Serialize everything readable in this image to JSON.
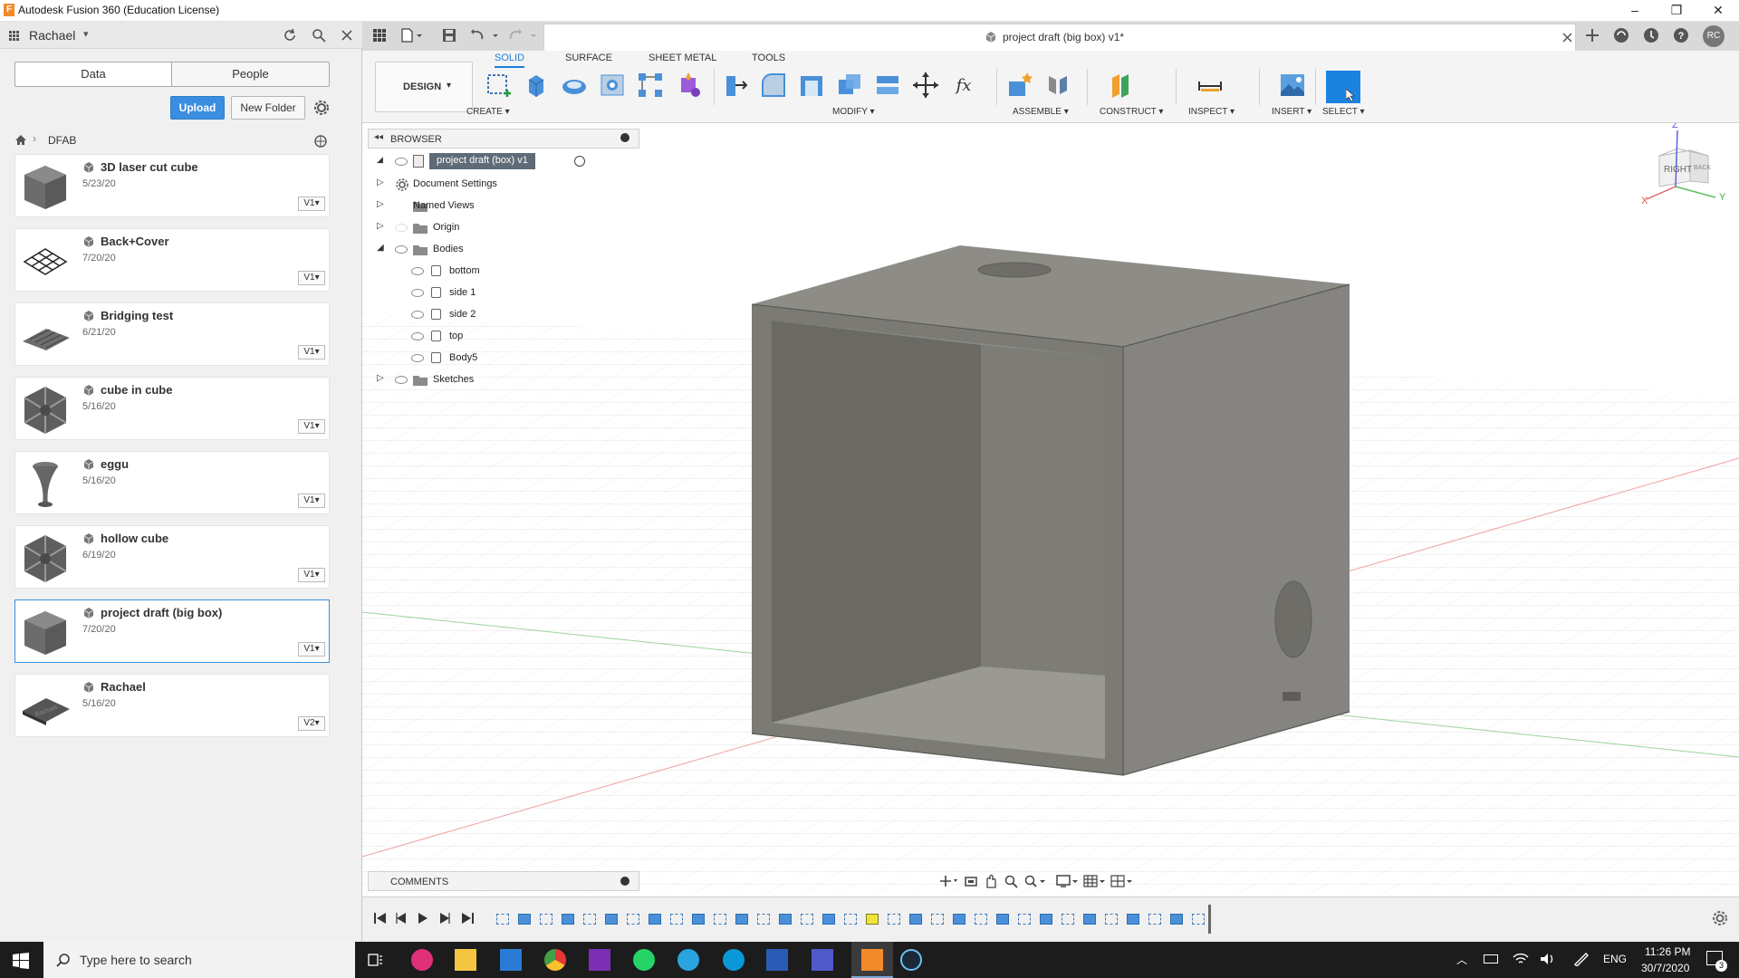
{
  "window": {
    "title": "Autodesk Fusion 360 (Education License)",
    "minimize": "–",
    "restore": "❐",
    "close": "✕"
  },
  "data_panel": {
    "user": "Rachael",
    "tabs": [
      "Data",
      "People"
    ],
    "upload": "Upload",
    "new_folder": "New Folder",
    "breadcrumb": "DFAB",
    "files": [
      {
        "name": "3D laser cut cube",
        "date": "5/23/20",
        "version": "V1",
        "thumb": "cube-thumb"
      },
      {
        "name": "Back+Cover",
        "date": "7/20/20",
        "version": "V1",
        "thumb": "grid-thumb"
      },
      {
        "name": "Bridging test",
        "date": "6/21/20",
        "version": "V1",
        "thumb": "plate-thumb"
      },
      {
        "name": "cube in cube",
        "date": "5/16/20",
        "version": "V1",
        "thumb": "hex-thumb"
      },
      {
        "name": "eggu",
        "date": "5/16/20",
        "version": "V1",
        "thumb": "cup-thumb"
      },
      {
        "name": "hollow cube",
        "date": "6/19/20",
        "version": "V1",
        "thumb": "hex-thumb"
      },
      {
        "name": "project draft (big box)",
        "date": "7/20/20",
        "version": "V1",
        "thumb": "cube-thumb",
        "selected": true
      },
      {
        "name": "Rachael",
        "date": "5/16/20",
        "version": "V2",
        "thumb": "tag-thumb"
      }
    ]
  },
  "document": {
    "tab_title": "project draft (big box) v1*"
  },
  "toolbar": {
    "workspace": "DESIGN",
    "tabs": [
      "SOLID",
      "SURFACE",
      "SHEET METAL",
      "TOOLS"
    ],
    "active_tab": "SOLID",
    "groups": [
      "CREATE",
      "MODIFY",
      "ASSEMBLE",
      "CONSTRUCT",
      "INSPECT",
      "INSERT",
      "SELECT"
    ]
  },
  "browser": {
    "title": "BROWSER",
    "root": "project draft (box) v1",
    "items": [
      "Document Settings",
      "Named Views",
      "Origin",
      "Bodies"
    ],
    "bodies": [
      "bottom",
      "side 1",
      "side 2",
      "top",
      "Body5"
    ],
    "sketches": "Sketches"
  },
  "viewcube": {
    "face": "RIGHT",
    "side": "BACK",
    "z": "Z",
    "x": "X",
    "y": "Y"
  },
  "comments": {
    "label": "COMMENTS"
  },
  "taskbar": {
    "search_placeholder": "Type here to search",
    "language": "ENG",
    "time": "11:26 PM",
    "date": "30/7/2020",
    "notifications": "3"
  },
  "user_initials": "RC"
}
